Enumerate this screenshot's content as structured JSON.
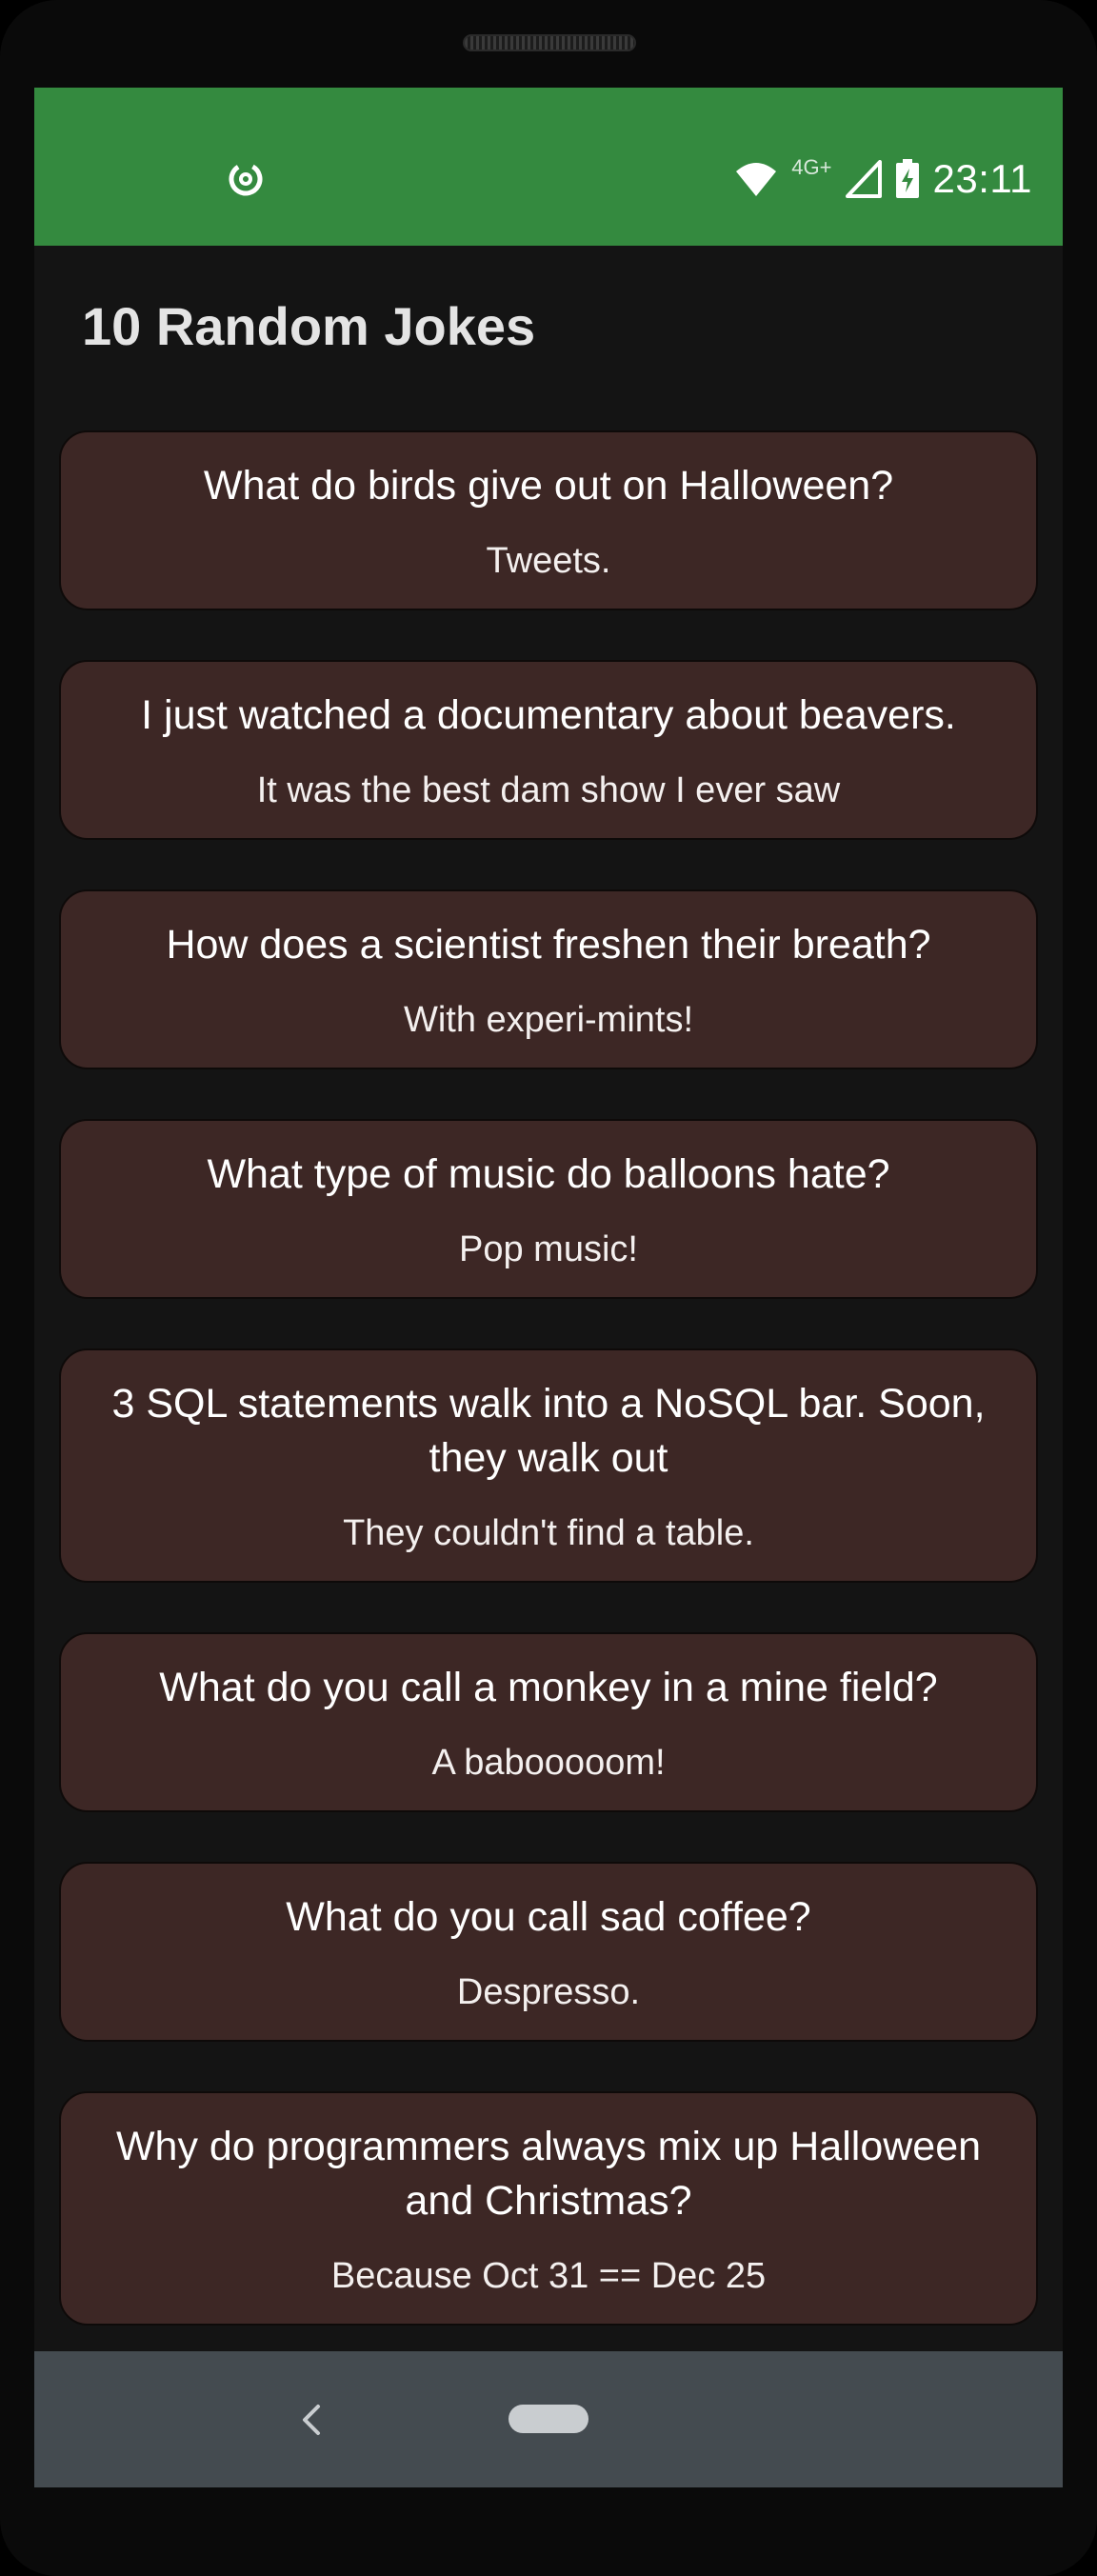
{
  "status_bar": {
    "app_icon": "data-saver-icon",
    "network_type": "4G+",
    "time": "23:11",
    "icons": [
      "wifi-icon",
      "cell-signal-icon",
      "battery-charging-icon"
    ],
    "background_color": "#348a3f"
  },
  "app": {
    "title": "10 Random Jokes"
  },
  "jokes": [
    {
      "setup": "What do birds give out on Halloween?",
      "punchline": "Tweets."
    },
    {
      "setup": "I just watched a documentary about beavers.",
      "punchline": "It was the best dam show I ever saw"
    },
    {
      "setup": "How does a scientist freshen their breath?",
      "punchline": "With experi-mints!"
    },
    {
      "setup": "What type of music do balloons hate?",
      "punchline": "Pop music!"
    },
    {
      "setup": "3 SQL statements walk into a NoSQL bar. Soon, they walk out",
      "punchline": "They couldn't find a table."
    },
    {
      "setup": "What do you call a monkey in a mine field?",
      "punchline": "A babooooom!"
    },
    {
      "setup": "What do you call sad coffee?",
      "punchline": "Despresso."
    },
    {
      "setup": "Why do programmers always mix up Halloween and Christmas?",
      "punchline": "Because Oct 31 == Dec 25"
    }
  ],
  "nav_bar": {
    "back_icon": "chevron-left-icon",
    "home_icon": "home-pill-icon"
  },
  "colors": {
    "card_background": "#3d2725",
    "screen_background": "#141414",
    "nav_background": "#444b50"
  }
}
